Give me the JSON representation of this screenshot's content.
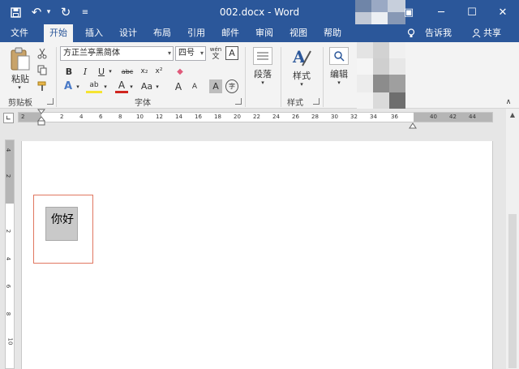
{
  "titlebar": {
    "doc_title": "002.docx  -  Word",
    "qa_save": "💾",
    "qa_undo": "↶",
    "qa_undo_caret": "▾",
    "qa_redo": "↻",
    "qa_customize": "≡",
    "ribbon_display": "▣",
    "minimize": "─",
    "restore": "☐",
    "close": "✕",
    "bg_color": "#2b579a"
  },
  "tabs": [
    {
      "label": "文件"
    },
    {
      "label": "开始"
    },
    {
      "label": "插入"
    },
    {
      "label": "设计"
    },
    {
      "label": "布局"
    },
    {
      "label": "引用"
    },
    {
      "label": "邮件"
    },
    {
      "label": "审阅"
    },
    {
      "label": "视图"
    },
    {
      "label": "帮助"
    }
  ],
  "active_tab": "开始",
  "tell_me": "告诉我",
  "share": "共享",
  "ribbon": {
    "clipboard": {
      "paste_label": "粘贴",
      "group_label": "剪贴板"
    },
    "font": {
      "font_name": "方正兰亭黑简体",
      "font_size": "四号",
      "wen": "wén",
      "wen_char": "文",
      "a_box": "A",
      "bold": "B",
      "italic": "I",
      "underline": "U",
      "strike": "abc",
      "sub": "x₂",
      "sup": "x²",
      "eraser": "◆",
      "text_effect": "A",
      "highlight": "ab",
      "font_color": "A",
      "aa": "Aa",
      "grow": "A",
      "shrink": "A",
      "char_shading": "A",
      "enclose": "字",
      "group_label": "字体"
    },
    "paragraph_label": "段落",
    "styles": {
      "label": "样式",
      "group_label": "样式"
    },
    "editing_label": "编辑"
  },
  "ruler_numbers": [
    "2",
    "2",
    "4",
    "6",
    "8",
    "10",
    "12",
    "14",
    "16",
    "18",
    "20",
    "22",
    "24",
    "26",
    "28",
    "30",
    "32",
    "34",
    "36",
    "40",
    "42",
    "44"
  ],
  "vruler_numbers": [
    "4",
    "2",
    "2",
    "4",
    "6",
    "8",
    "10"
  ],
  "document": {
    "textbox_text": "你好"
  },
  "colors": {
    "accent": "#2b579a",
    "textbox_border": "#e07760",
    "textbox_fill": "#c9c9c9"
  }
}
